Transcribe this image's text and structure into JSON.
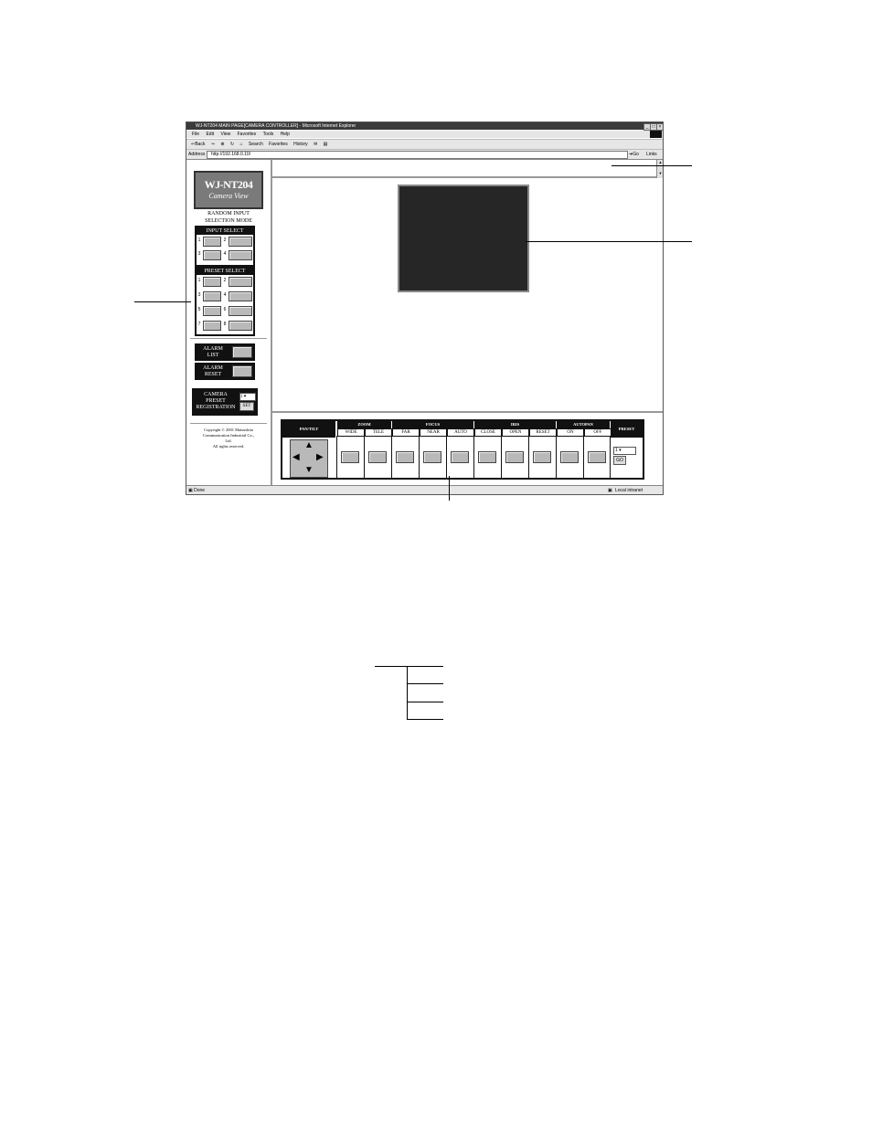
{
  "browser": {
    "title": "WJ-NT204 MAIN PAGE[CAMERA CONTROLLER] - Microsoft Internet Explorer",
    "menu": [
      "File",
      "Edit",
      "View",
      "Favorites",
      "Tools",
      "Help"
    ],
    "toolbar": [
      "Back",
      "Search",
      "Favorites",
      "History"
    ],
    "address_label": "Address",
    "address_value": "http://192.168.0.10/",
    "go_label": "Go",
    "links_label": "Links",
    "status_left": "Done",
    "status_right": "Local intranet"
  },
  "left": {
    "logo_line1": "WJ-NT204",
    "logo_line2": "Camera View",
    "mode_line1": "RANDOM INPUT",
    "mode_line2": "SELECTION MODE",
    "input_select": "INPUT SELECT",
    "input_numbers": [
      "1",
      "2",
      "3",
      "4"
    ],
    "preset_select": "PRESET SELECT",
    "preset_numbers": [
      "1",
      "2",
      "3",
      "4",
      "5",
      "6",
      "7",
      "8"
    ],
    "alarm_list_1": "ALARM",
    "alarm_list_2": "LIST",
    "alarm_reset_1": "ALARM",
    "alarm_reset_2": "RESET",
    "cam_preset_1": "CAMERA",
    "cam_preset_2": "PRESET",
    "cam_preset_3": "REGISTRATION",
    "cam_preset_value": "1",
    "set_label": "SET",
    "copyright_1": "Copyright © 2001 Matsushita",
    "copyright_2": "Communication Industrial Co.,",
    "copyright_3": "Ltd.",
    "copyright_4": "All rights reserved."
  },
  "control": {
    "pantilt": "PAN/TILT",
    "zoom": "ZOOM",
    "focus": "FOCUS",
    "iris": "IRIS",
    "autopan": "AUTOPAN",
    "preset": "PRESET",
    "wide": "WIDE",
    "tele": "TELE",
    "far": "FAR",
    "near": "NEAR",
    "auto": "AUTO",
    "close": "CLOSE",
    "open": "OPEN",
    "reset": "RESET",
    "on": "ON",
    "off": "OFF",
    "preset_value": "1",
    "go": "GO"
  },
  "colors": {
    "panel_black": "#111111",
    "button_gray": "#b9b9b9",
    "video_bg": "#262626"
  }
}
